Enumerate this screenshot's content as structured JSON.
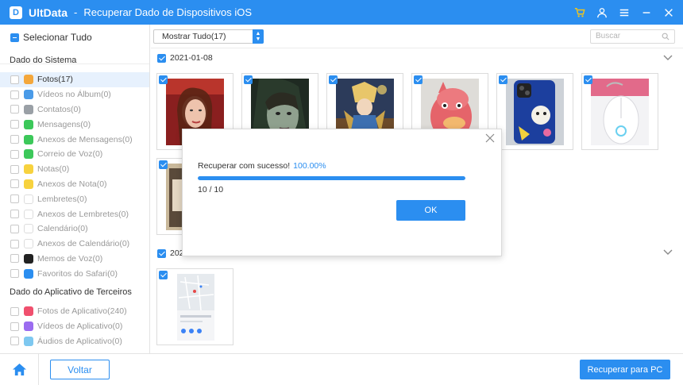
{
  "titlebar": {
    "logo_letter": "D",
    "app_name": "UltData",
    "separator": "-",
    "title": "Recuperar Dado de Dispositivos iOS",
    "icons": [
      "cart-icon",
      "user-icon",
      "menu-icon",
      "minimize-icon",
      "close-icon"
    ]
  },
  "sidebar": {
    "select_all": "Selecionar Tudo",
    "system_header": "Dado do Sistema",
    "system_items": [
      {
        "label": "Fotos(17)",
        "icon": "photos-icon",
        "color": "#f4a73b"
      },
      {
        "label": "Vídeos no Álbum(0)",
        "icon": "album-video-icon",
        "color": "#4a9be8"
      },
      {
        "label": "Contatos(0)",
        "icon": "contacts-icon",
        "color": "#9aa0a6"
      },
      {
        "label": "Mensagens(0)",
        "icon": "messages-icon",
        "color": "#3cc85a"
      },
      {
        "label": "Anexos de Mensagens(0)",
        "icon": "message-attachment-icon",
        "color": "#3cc85a"
      },
      {
        "label": "Correio de Voz(0)",
        "icon": "voicemail-icon",
        "color": "#3cc85a"
      },
      {
        "label": "Notas(0)",
        "icon": "notes-icon",
        "color": "#f7d23e"
      },
      {
        "label": "Anexos de Nota(0)",
        "icon": "note-attachment-icon",
        "color": "#f7d23e"
      },
      {
        "label": "Lembretes(0)",
        "icon": "reminders-icon",
        "color": "#ffffff"
      },
      {
        "label": "Anexos de Lembretes(0)",
        "icon": "reminder-attachment-icon",
        "color": "#ffffff"
      },
      {
        "label": "Calendário(0)",
        "icon": "calendar-icon",
        "color": "#ffffff"
      },
      {
        "label": "Anexos de Calendário(0)",
        "icon": "calendar-attachment-icon",
        "color": "#ffffff"
      },
      {
        "label": "Memos de Voz(0)",
        "icon": "voice-memo-icon",
        "color": "#222222"
      },
      {
        "label": "Favoritos do Safari(0)",
        "icon": "safari-icon",
        "color": "#2b8ef0"
      }
    ],
    "third_party_header": "Dado do Aplicativo de Terceiros",
    "third_party_items": [
      {
        "label": "Fotos de Aplicativo(240)",
        "icon": "app-photos-icon",
        "color": "#f0506e"
      },
      {
        "label": "Vídeos de Aplicativo(0)",
        "icon": "app-videos-icon",
        "color": "#9b6cf0"
      },
      {
        "label": "Áudios de Aplicativo(0)",
        "icon": "app-audio-icon",
        "color": "#7ec8f0"
      }
    ]
  },
  "toolbar": {
    "filter_value": "Mostrar Tudo(17)",
    "search_placeholder": "Buscar"
  },
  "groups": [
    {
      "date": "2021-01-08"
    },
    {
      "date": "202"
    }
  ],
  "dialog": {
    "message": "Recuperar com sucesso!",
    "percent": "100.00%",
    "progress": 1.0,
    "count": "10 / 10",
    "ok_label": "OK"
  },
  "bottom": {
    "back_label": "Voltar",
    "recover_label": "Recuperar para PC"
  },
  "colors": {
    "accent": "#2b8ef0"
  }
}
